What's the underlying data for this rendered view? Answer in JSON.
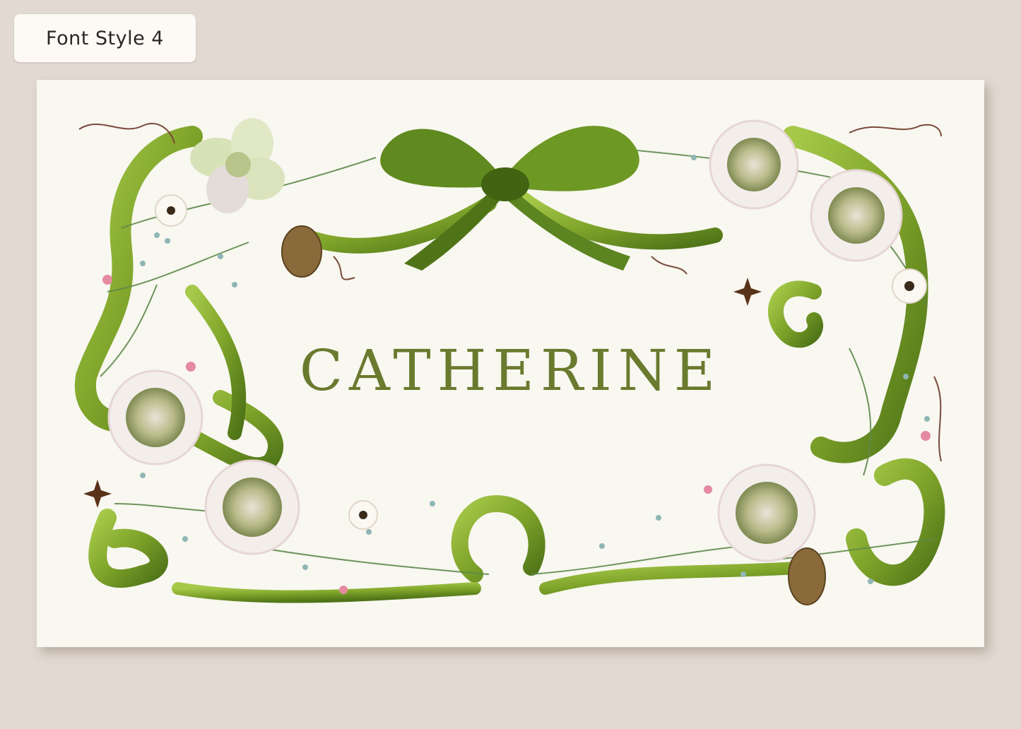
{
  "style_label": "Font Style 4",
  "card": {
    "name": "CATHERINE",
    "name_color": "#6a7a2e",
    "ribbon_color": "#7fa42a",
    "ribbon_dark": "#4f7418",
    "foliage_color": "#5e8a4a",
    "flower_petal_color": "#f3eeea",
    "flower_center_color": "#a8ad7a",
    "background": "#f8f7f0"
  }
}
